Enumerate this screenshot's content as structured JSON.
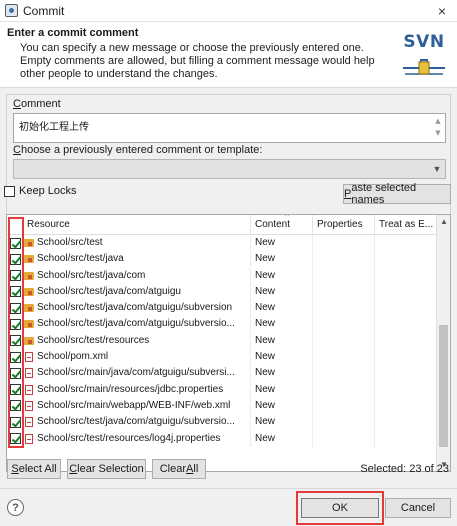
{
  "window": {
    "title": "Commit",
    "close_glyph": "×"
  },
  "banner": {
    "title": "Enter a commit comment",
    "description": "You can specify a new message or choose the previously entered one. Empty comments are allowed, but filling a comment message would help other people to understand the changes.",
    "logo_text": "SVN"
  },
  "comment": {
    "label_underlined": "C",
    "label_rest": "omment",
    "value": "初始化工程上传"
  },
  "template": {
    "label_underlined": "C",
    "label_rest": "hoose a previously entered comment or template:",
    "selected": ""
  },
  "keep_locks": {
    "label": "Keep Locks",
    "checked": false
  },
  "paste_button": {
    "underlined": "P",
    "rest": "aste selected names"
  },
  "table": {
    "columns": [
      "Resource",
      "Content",
      "Properties",
      "Treat as E..."
    ],
    "rows": [
      {
        "icon": "folder-icon",
        "path": "School/src/test",
        "content": "New"
      },
      {
        "icon": "folder-icon",
        "path": "School/src/test/java",
        "content": "New"
      },
      {
        "icon": "folder-icon",
        "path": "School/src/test/java/com",
        "content": "New"
      },
      {
        "icon": "folder-icon",
        "path": "School/src/test/java/com/atguigu",
        "content": "New"
      },
      {
        "icon": "folder-icon",
        "path": "School/src/test/java/com/atguigu/subversion",
        "content": "New"
      },
      {
        "icon": "folder-icon",
        "path": "School/src/test/java/com/atguigu/subversio...",
        "content": "New"
      },
      {
        "icon": "folder-icon",
        "path": "School/src/test/resources",
        "content": "New"
      },
      {
        "icon": "file-icon",
        "path": "School/pom.xml",
        "content": "New"
      },
      {
        "icon": "file-icon",
        "path": "School/src/main/java/com/atguigu/subversi...",
        "content": "New"
      },
      {
        "icon": "file-icon",
        "path": "School/src/main/resources/jdbc.properties",
        "content": "New"
      },
      {
        "icon": "file-icon",
        "path": "School/src/main/webapp/WEB-INF/web.xml",
        "content": "New"
      },
      {
        "icon": "file-icon",
        "path": "School/src/test/java/com/atguigu/subversio...",
        "content": "New"
      },
      {
        "icon": "file-icon",
        "path": "School/src/test/resources/log4j.properties",
        "content": "New"
      }
    ]
  },
  "selection_buttons": {
    "select_all": {
      "underlined": "S",
      "rest": "elect All"
    },
    "clear_selection": {
      "underlined": "C",
      "rest": "lear Selection"
    },
    "clear_all": {
      "before": "Clear ",
      "underlined": "A",
      "rest": "ll"
    }
  },
  "selected_count": "Selected: 23 of 23",
  "footer": {
    "help_glyph": "?",
    "ok_label": "OK",
    "cancel_label": "Cancel"
  },
  "colors": {
    "highlight_box": "#e23b3b",
    "logo_blue": "#2f5f99"
  }
}
